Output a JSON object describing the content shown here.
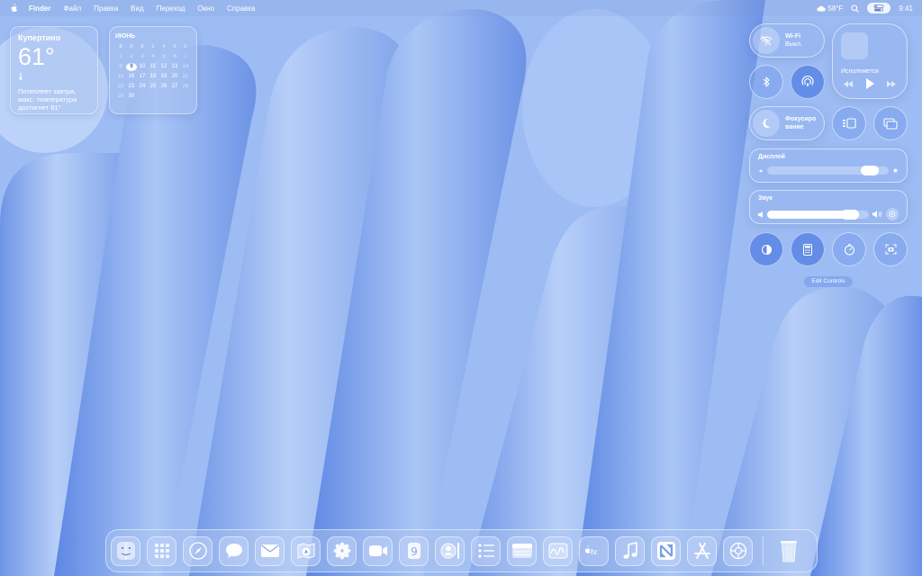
{
  "menubar": {
    "app_name": "Finder",
    "menus": [
      "Файл",
      "Правка",
      "Вид",
      "Переход",
      "Окно",
      "Справка"
    ],
    "weather": "58°F",
    "time": "9:41",
    "icons": [
      "apple-icon",
      "cloud-icon",
      "search-icon",
      "control-center-icon"
    ]
  },
  "weather_widget": {
    "city": "Купертино",
    "temperature": "61°",
    "description": "Потеплеет завтра, макс. температура достигнет 81°"
  },
  "calendar_widget": {
    "month": "июнь",
    "weekdays": [
      "в",
      "п",
      "в",
      "с",
      "ч",
      "п",
      "с"
    ],
    "weeks": [
      [
        "1",
        "2",
        "3",
        "4",
        "5",
        "6",
        "7"
      ],
      [
        "8",
        "9",
        "10",
        "11",
        "12",
        "13",
        "14"
      ],
      [
        "15",
        "16",
        "17",
        "18",
        "19",
        "20",
        "21"
      ],
      [
        "22",
        "23",
        "24",
        "25",
        "26",
        "27",
        "28"
      ],
      [
        "29",
        "30",
        "",
        "",
        "",
        "",
        ""
      ]
    ],
    "today": "9"
  },
  "control_center": {
    "wifi": {
      "title": "Wi-Fi",
      "status": "Выкл."
    },
    "now_playing": {
      "label": "Исполняется"
    },
    "focus": {
      "title": "Фокусиро",
      "title_line2": "вание"
    },
    "display": {
      "label": "Дисплей",
      "level": 0.92
    },
    "sound": {
      "label": "Звук",
      "level": 0.9
    },
    "edit_controls": "Edit Controls"
  },
  "dock": {
    "apps": [
      "finder",
      "launchpad",
      "safari",
      "messages",
      "mail",
      "maps",
      "photos",
      "facetime",
      "phone",
      "contacts",
      "notes",
      "reminders",
      "freeform",
      "tv",
      "music",
      "news",
      "app-store",
      "system-settings"
    ],
    "trash": "trash"
  },
  "colors": {
    "accent": "#4f7de0",
    "wallpaper": "#8fb3f0"
  }
}
